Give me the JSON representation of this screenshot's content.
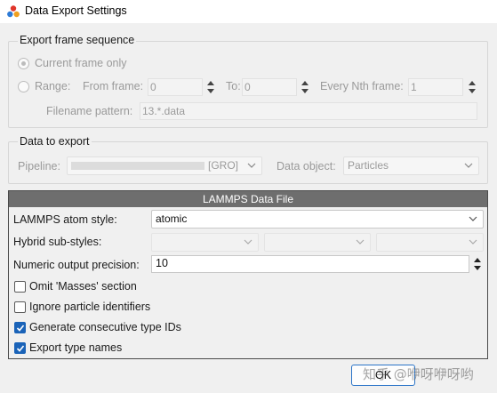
{
  "window": {
    "title": "Data Export Settings",
    "icon": "ovito-app-icon"
  },
  "frame_sequence": {
    "title": "Export frame sequence",
    "current_frame_label": "Current frame only",
    "range_label": "Range:",
    "from_label": "From frame:",
    "from_value": "0",
    "to_label": "To:",
    "to_value": "0",
    "nth_label": "Every Nth frame:",
    "nth_value": "1",
    "filename_label": "Filename pattern:",
    "filename_value": "13.*.data"
  },
  "data_to_export": {
    "title": "Data to export",
    "pipeline_label": "Pipeline:",
    "pipeline_value": "[GRO]",
    "data_object_label": "Data object:",
    "data_object_value": "Particles"
  },
  "lammps": {
    "header": "LAMMPS Data File",
    "atom_style_label": "LAMMPS atom style:",
    "atom_style_value": "atomic",
    "hybrid_label": "Hybrid sub-styles:",
    "precision_label": "Numeric output precision:",
    "precision_value": "10",
    "options": [
      {
        "label": "Omit 'Masses' section",
        "checked": false
      },
      {
        "label": "Ignore particle identifiers",
        "checked": false
      },
      {
        "label": "Generate consecutive type IDs",
        "checked": true
      },
      {
        "label": "Export type names",
        "checked": true
      }
    ]
  },
  "buttons": {
    "ok": "OK"
  },
  "watermark": "知乎 @咿呀咿呀哟",
  "colors": {
    "accent": "#1a63b8",
    "panel_header": "#6e6e6e"
  }
}
